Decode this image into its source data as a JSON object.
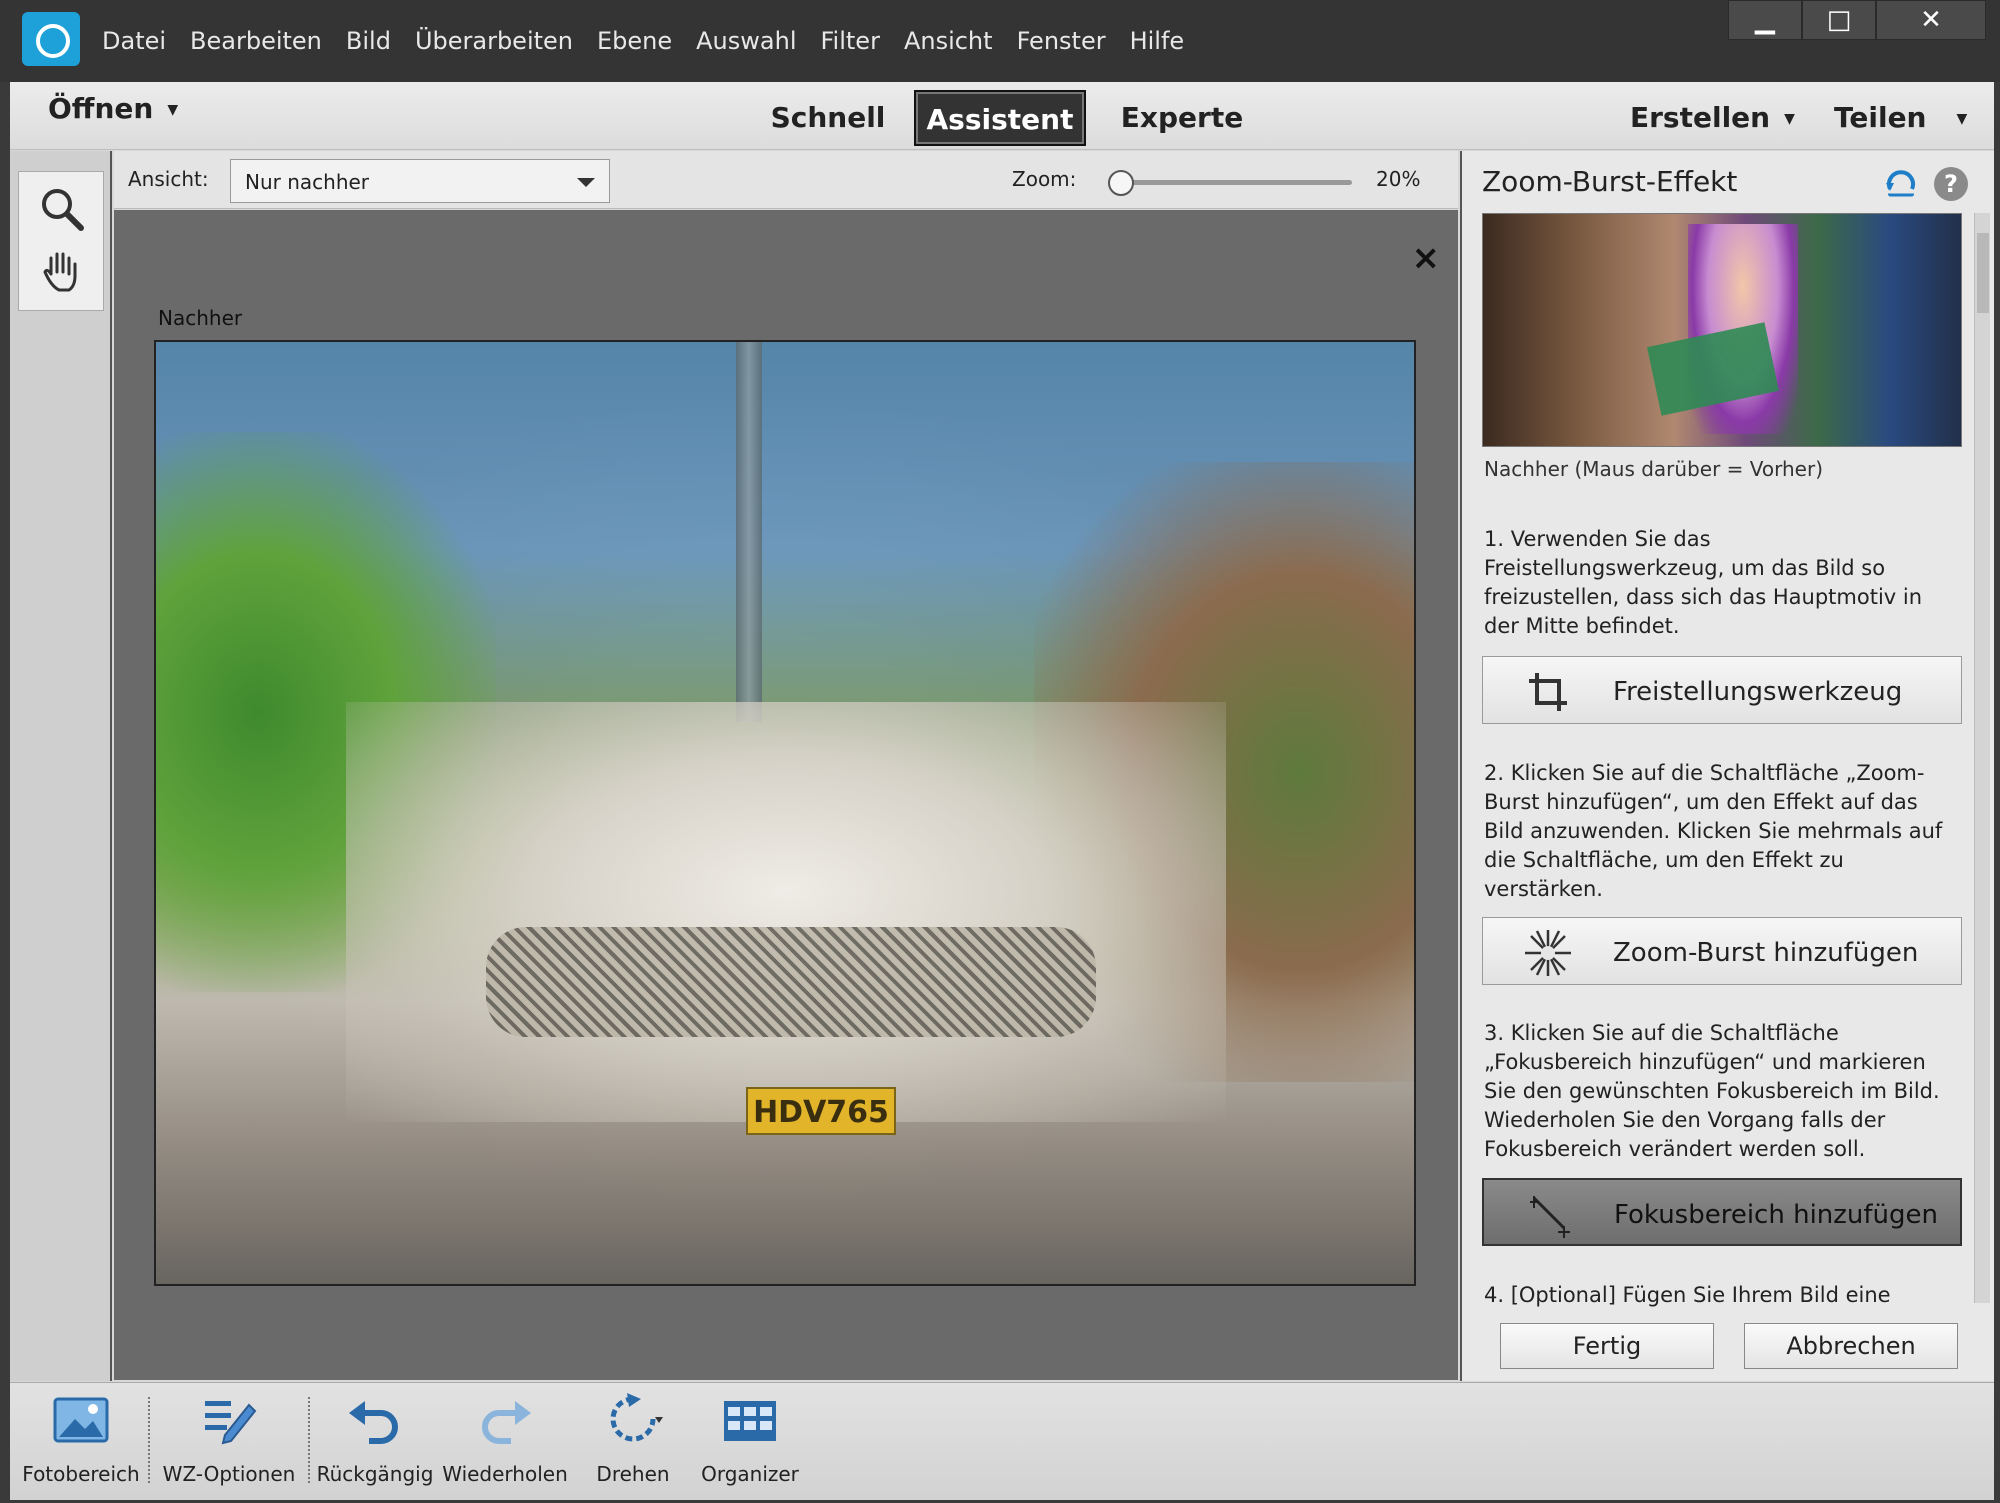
{
  "menu": [
    "Datei",
    "Bearbeiten",
    "Bild",
    "Überarbeiten",
    "Ebene",
    "Auswahl",
    "Filter",
    "Ansicht",
    "Fenster",
    "Hilfe"
  ],
  "window_controls": {
    "minimize": "▁",
    "maximize": "□",
    "close": "✕"
  },
  "modebar": {
    "open_label": "Öffnen",
    "tabs": [
      "Schnell",
      "Assistent",
      "Experte"
    ],
    "active_tab": "Assistent",
    "create_label": "Erstellen",
    "share_label": "Teilen"
  },
  "options": {
    "view_label": "Ansicht:",
    "view_value": "Nur nachher",
    "zoom_label": "Zoom:",
    "zoom_value": "20%",
    "zoom_level": 0.2
  },
  "canvas": {
    "close_label": "×",
    "image_label": "Nachher",
    "plate_text": "HDV765"
  },
  "panel": {
    "title": "Zoom-Burst-Effekt",
    "preview_caption": "Nachher (Maus darüber = Vorher)",
    "step1": "1. Verwenden Sie das Freistellungswerkzeug, um das Bild so freizustellen, dass sich das Hauptmotiv in der Mitte befindet.",
    "button1": "Freistellungswerkzeug",
    "step2": "2. Klicken Sie auf die Schaltfläche „Zoom-Burst hinzufügen“, um den Effekt auf das Bild anzuwenden. Klicken Sie mehrmals auf die Schaltfläche, um den Effekt zu verstärken.",
    "button2": "Zoom-Burst hinzufügen",
    "step3": "3. Klicken Sie auf die Schaltfläche „Fokusbereich hinzufügen“ und markieren Sie den gewünschten Fokusbereich im Bild. Wiederholen Sie den Vorgang falls der Fokusbereich verändert werden soll.",
    "button3": "Fokusbereich hinzufügen",
    "step4": "4. [Optional] Fügen Sie Ihrem Bild eine",
    "done_label": "Fertig",
    "cancel_label": "Abbrechen",
    "help_label": "?"
  },
  "bottombar": [
    {
      "label": "Fotobereich",
      "icon": "photo-bin-icon"
    },
    {
      "label": "WZ-Optionen",
      "icon": "tool-options-icon"
    },
    {
      "label": "Rückgängig",
      "icon": "undo-icon"
    },
    {
      "label": "Wiederholen",
      "icon": "redo-icon"
    },
    {
      "label": "Drehen",
      "icon": "rotate-icon"
    },
    {
      "label": "Organizer",
      "icon": "organizer-icon"
    }
  ],
  "colors": {
    "accent": "#1ea1d8",
    "titlebar": "#343434"
  }
}
